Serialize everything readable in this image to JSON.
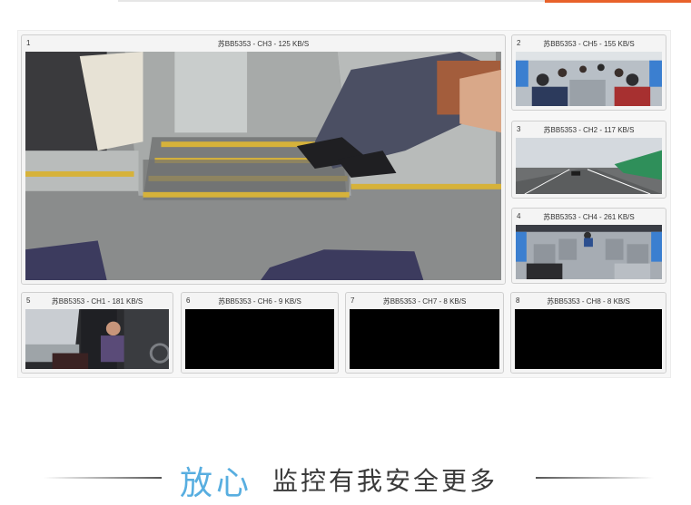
{
  "channels": [
    {
      "number": "1",
      "caption": "苏BB5353 - CH3 - 125 KB/S",
      "feed": "stairwell-view"
    },
    {
      "number": "2",
      "caption": "苏BB5353 - CH5 - 155 KB/S",
      "feed": "passenger-cabin-view"
    },
    {
      "number": "3",
      "caption": "苏BB5353 - CH2 - 117 KB/S",
      "feed": "road-front-view"
    },
    {
      "number": "4",
      "caption": "苏BB5353 - CH4 - 261 KB/S",
      "feed": "passenger-cabin-rear-view"
    },
    {
      "number": "5",
      "caption": "苏BB5353 - CH1 - 181 KB/S",
      "feed": "driver-view"
    },
    {
      "number": "6",
      "caption": "苏BB5353 - CH6 - 9 KB/S",
      "feed": "no-signal"
    },
    {
      "number": "7",
      "caption": "苏BB5353 - CH7 - 8 KB/S",
      "feed": "no-signal"
    },
    {
      "number": "8",
      "caption": "苏BB5353 - CH8 - 8 KB/S",
      "feed": "no-signal"
    }
  ],
  "slogan": {
    "highlight": "放心",
    "rest": "监控有我安全更多"
  },
  "colors": {
    "accent_blue": "#58aee0",
    "accent_orange": "#e8622a",
    "no_signal": "#000000"
  }
}
